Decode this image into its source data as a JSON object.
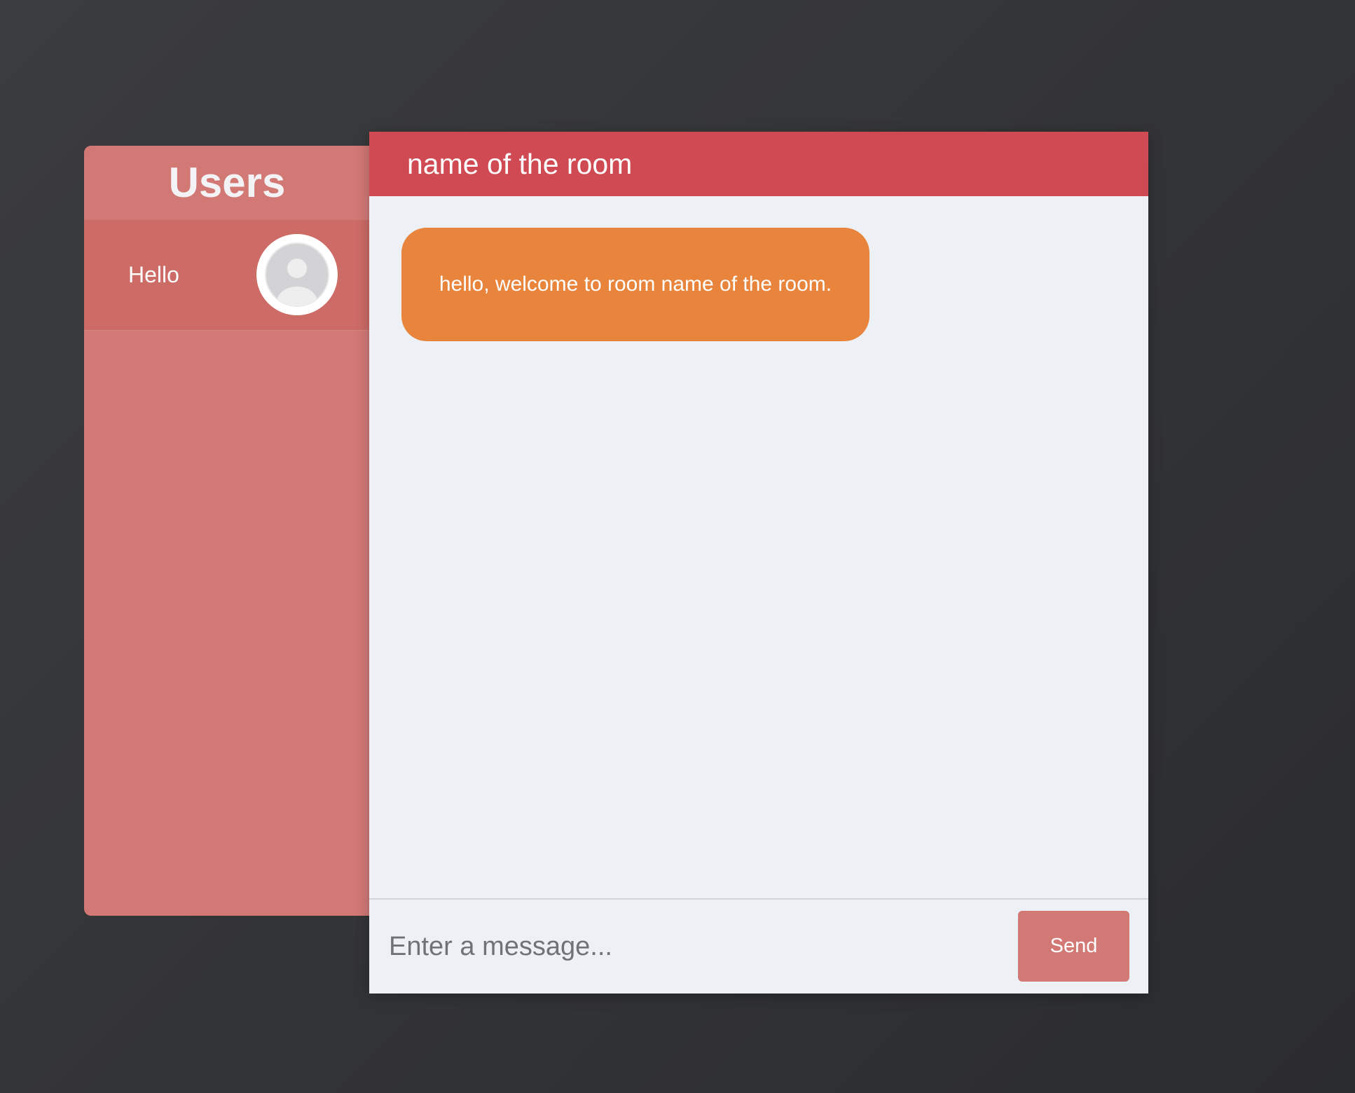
{
  "sidebar": {
    "title": "Users",
    "users": [
      {
        "name": "Hello",
        "avatar_icon": "user-avatar-icon"
      }
    ]
  },
  "chat": {
    "room_name": "name of the room",
    "messages": [
      {
        "text": "hello, welcome to room name of the room."
      }
    ],
    "input": {
      "placeholder": "Enter a message...",
      "value": ""
    },
    "send_label": "Send"
  },
  "colors": {
    "background": "#353638",
    "sidebar": "#d27976",
    "sidebar_item": "#cd6b67",
    "header": "#cf4a52",
    "chat_background": "#edf1f5",
    "message_bubble": "#e8843b",
    "send_button": "#d27976"
  }
}
